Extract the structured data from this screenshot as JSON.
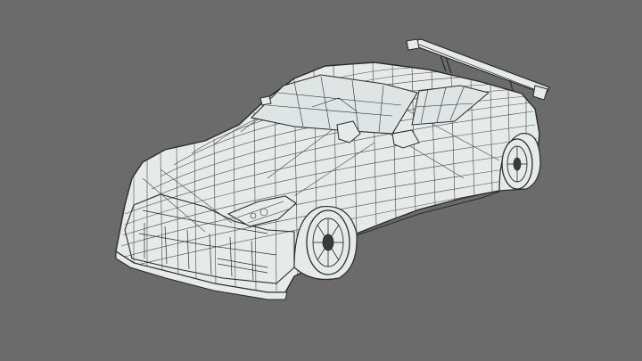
{
  "viewport": {
    "background_color": "#6b6b6b",
    "surface_color": "#e6ebea",
    "wire_color": "#2a2c2c",
    "tire_color": "#3a3c3c"
  },
  "subject": {
    "icon": "wireframe-sports-car-icon"
  }
}
